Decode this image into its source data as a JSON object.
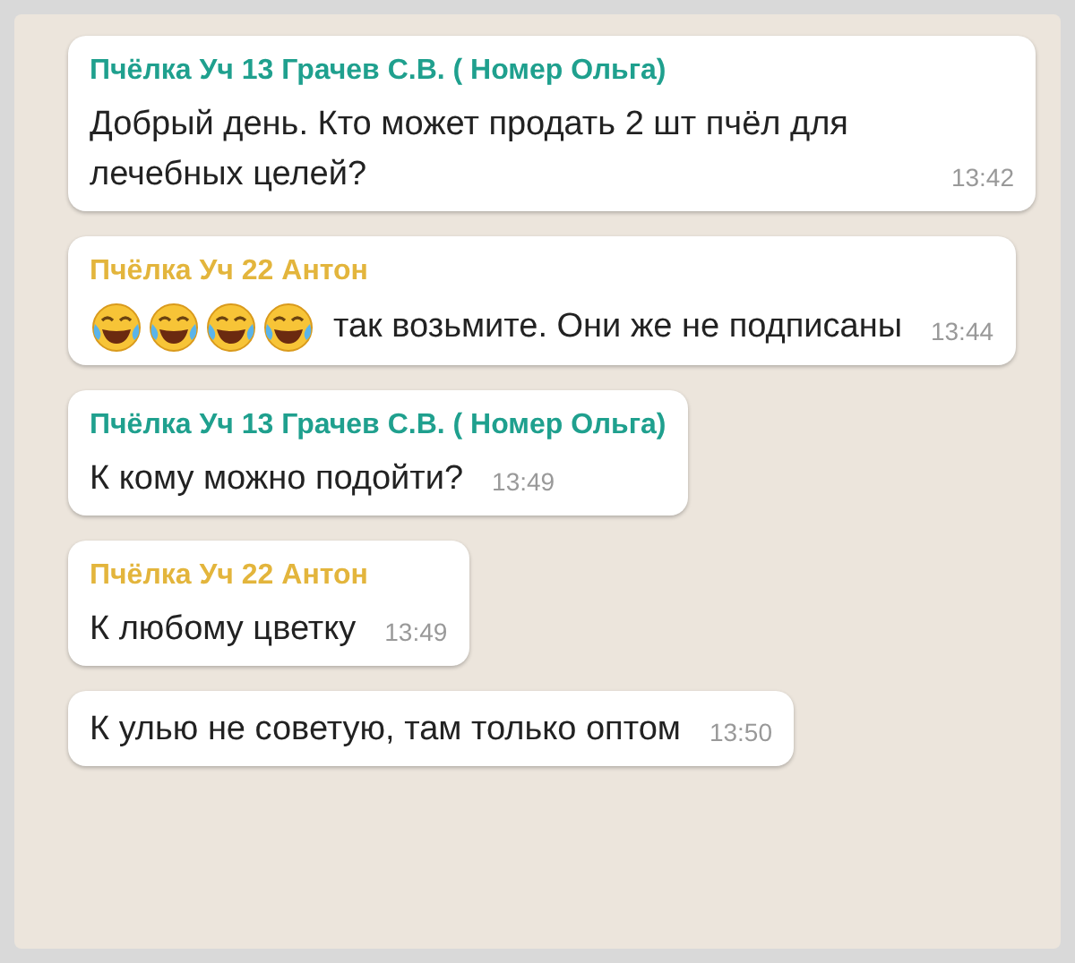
{
  "messages": [
    {
      "sender": "Пчёлка Уч 13 Грачев С.В. ( Номер Ольга)",
      "color": "#1fa08e",
      "text": "Добрый день. Кто может продать 2 шт пчёл для лечебных целей?",
      "time": "13:42"
    },
    {
      "sender": "Пчёлка Уч 22 Антон",
      "color": "#e3b53c",
      "emojis": [
        {
          "kind": "laughing"
        },
        {
          "kind": "laughing"
        },
        {
          "kind": "laughing"
        },
        {
          "kind": "laughing"
        }
      ],
      "text": "так возьмите. Они же не подписаны",
      "time": "13:44"
    },
    {
      "sender": "Пчёлка Уч 13 Грачев С.В. ( Номер Ольга)",
      "color": "#1fa08e",
      "text": "К кому можно подойти?",
      "time": "13:49"
    },
    {
      "sender": "Пчёлка Уч 22 Антон",
      "color": "#e3b53c",
      "text": "К любому цветку",
      "time": "13:49"
    },
    {
      "text": "К улью не советую, там только оптом",
      "time": "13:50"
    }
  ]
}
